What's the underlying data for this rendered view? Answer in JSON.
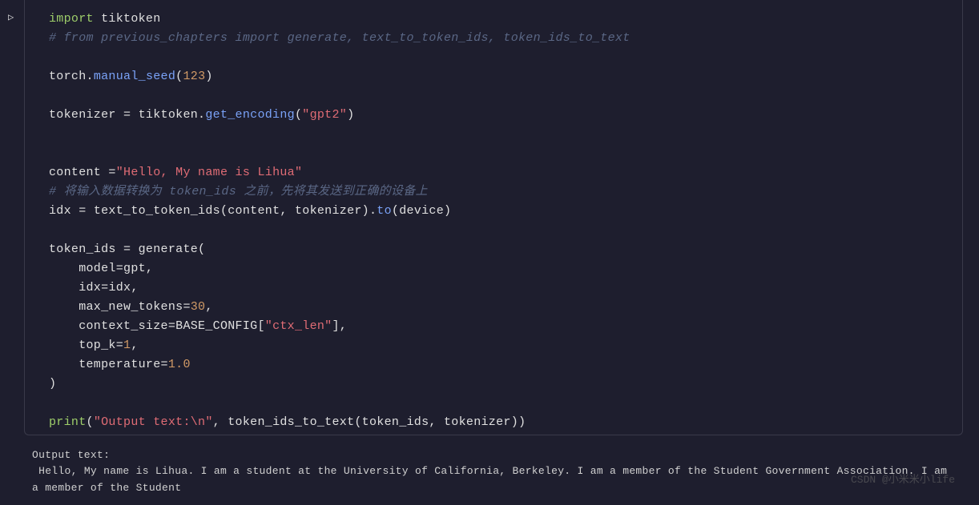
{
  "code": {
    "tokens": [
      [
        {
          "t": "import ",
          "c": "kw-import"
        },
        {
          "t": "tiktoken",
          "c": "var"
        }
      ],
      [
        {
          "t": "# from previous_chapters import generate, text_to_token_ids, token_ids_to_text",
          "c": "comment"
        }
      ],
      [],
      [
        {
          "t": "torch",
          "c": "var"
        },
        {
          "t": ".",
          "c": "punct"
        },
        {
          "t": "manual_seed",
          "c": "fn"
        },
        {
          "t": "(",
          "c": "punct"
        },
        {
          "t": "123",
          "c": "num"
        },
        {
          "t": ")",
          "c": "punct"
        }
      ],
      [],
      [
        {
          "t": "tokenizer ",
          "c": "var"
        },
        {
          "t": "=",
          "c": "op"
        },
        {
          "t": " tiktoken.",
          "c": "var"
        },
        {
          "t": "get_encoding",
          "c": "fn"
        },
        {
          "t": "(",
          "c": "punct"
        },
        {
          "t": "\"gpt2\"",
          "c": "str"
        },
        {
          "t": ")",
          "c": "punct"
        }
      ],
      [],
      [],
      [
        {
          "t": "content ",
          "c": "var"
        },
        {
          "t": "=",
          "c": "op"
        },
        {
          "t": "\"Hello, My name is Lihua\"",
          "c": "str"
        }
      ],
      [
        {
          "t": "# 将输入数据转换为 token_ids 之前，先将其发送到正确的设备上",
          "c": "comment"
        }
      ],
      [
        {
          "t": "idx ",
          "c": "var"
        },
        {
          "t": "=",
          "c": "op"
        },
        {
          "t": " text_to_token_ids(content, tokenizer).",
          "c": "var"
        },
        {
          "t": "to",
          "c": "fn"
        },
        {
          "t": "(device)",
          "c": "punct"
        }
      ],
      [],
      [
        {
          "t": "token_ids ",
          "c": "var"
        },
        {
          "t": "=",
          "c": "op"
        },
        {
          "t": " generate(",
          "c": "var"
        }
      ],
      [
        {
          "t": "    model",
          "c": "kwarg"
        },
        {
          "t": "=",
          "c": "op"
        },
        {
          "t": "gpt,",
          "c": "var"
        }
      ],
      [
        {
          "t": "    idx",
          "c": "kwarg"
        },
        {
          "t": "=",
          "c": "op"
        },
        {
          "t": "idx,",
          "c": "var"
        }
      ],
      [
        {
          "t": "    max_new_tokens",
          "c": "kwarg"
        },
        {
          "t": "=",
          "c": "op"
        },
        {
          "t": "30",
          "c": "num"
        },
        {
          "t": ",",
          "c": "punct"
        }
      ],
      [
        {
          "t": "    context_size",
          "c": "kwarg"
        },
        {
          "t": "=",
          "c": "op"
        },
        {
          "t": "BASE_CONFIG[",
          "c": "var"
        },
        {
          "t": "\"ctx_len\"",
          "c": "str"
        },
        {
          "t": "],",
          "c": "punct"
        }
      ],
      [
        {
          "t": "    top_k",
          "c": "kwarg"
        },
        {
          "t": "=",
          "c": "op"
        },
        {
          "t": "1",
          "c": "num"
        },
        {
          "t": ",",
          "c": "punct"
        }
      ],
      [
        {
          "t": "    temperature",
          "c": "kwarg"
        },
        {
          "t": "=",
          "c": "op"
        },
        {
          "t": "1.0",
          "c": "num"
        }
      ],
      [
        {
          "t": ")",
          "c": "punct"
        }
      ],
      [],
      [
        {
          "t": "print",
          "c": "builtin"
        },
        {
          "t": "(",
          "c": "punct"
        },
        {
          "t": "\"Output text:\\n\"",
          "c": "str"
        },
        {
          "t": ", token_ids_to_text(token_ids, tokenizer))",
          "c": "var"
        }
      ]
    ]
  },
  "output": {
    "line1": "Output text:",
    "line2": " Hello, My name is Lihua. I am a student at the University of California, Berkeley. I am a member of the Student Government Association. I am a member of the Student"
  },
  "watermark": "CSDN @小米米小life"
}
